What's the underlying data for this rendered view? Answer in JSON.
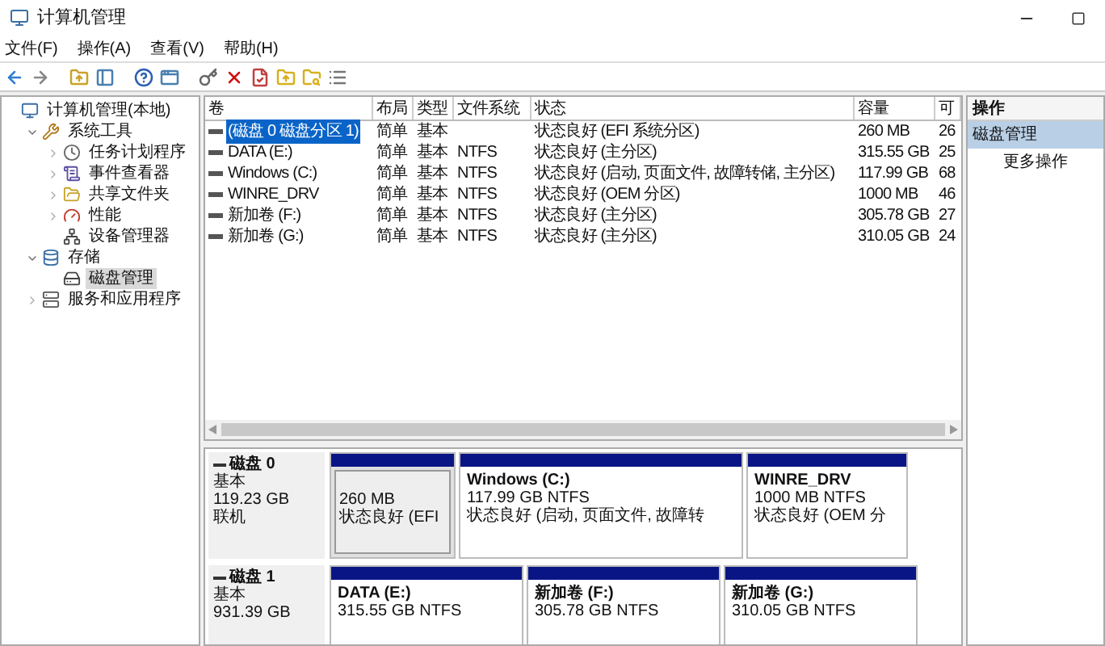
{
  "window": {
    "title": "计算机管理"
  },
  "menu": [
    "文件(F)",
    "操作(A)",
    "查看(V)",
    "帮助(H)"
  ],
  "tree": [
    {
      "label": "计算机管理(本地)",
      "selected": false,
      "children": [
        {
          "label": "系统工具",
          "expanded": true,
          "selected": false,
          "children": [
            {
              "label": "任务计划程序",
              "expanded": false,
              "selected": false
            },
            {
              "label": "事件查看器",
              "expanded": false,
              "selected": false
            },
            {
              "label": "共享文件夹",
              "expanded": false,
              "selected": false
            },
            {
              "label": "性能",
              "expanded": false,
              "selected": false
            },
            {
              "label": "设备管理器",
              "selected": false
            }
          ]
        },
        {
          "label": "存储",
          "expanded": true,
          "selected": false,
          "children": [
            {
              "label": "磁盘管理",
              "selected": true
            }
          ]
        },
        {
          "label": "服务和应用程序",
          "expanded": false,
          "selected": false
        }
      ]
    }
  ],
  "table": {
    "columns": [
      "卷",
      "布局",
      "类型",
      "文件系统",
      "状态",
      "容量",
      "可"
    ],
    "rows": [
      {
        "cells": [
          "(磁盘 0 磁盘分区 1)",
          "简单",
          "基本",
          "",
          "状态良好 (EFI 系统分区)",
          "260 MB",
          "26"
        ],
        "selected": true
      },
      {
        "cells": [
          "DATA (E:)",
          "简单",
          "基本",
          "NTFS",
          "状态良好 (主分区)",
          "315.55 GB",
          "25"
        ],
        "selected": false
      },
      {
        "cells": [
          "Windows (C:)",
          "简单",
          "基本",
          "NTFS",
          "状态良好 (启动, 页面文件, 故障转储, 主分区)",
          "117.99 GB",
          "68"
        ],
        "selected": false
      },
      {
        "cells": [
          "WINRE_DRV",
          "简单",
          "基本",
          "NTFS",
          "状态良好 (OEM 分区)",
          "1000 MB",
          "46"
        ],
        "selected": false
      },
      {
        "cells": [
          "新加卷 (F:)",
          "简单",
          "基本",
          "NTFS",
          "状态良好 (主分区)",
          "305.78 GB",
          "27"
        ],
        "selected": false
      },
      {
        "cells": [
          "新加卷 (G:)",
          "简单",
          "基本",
          "NTFS",
          "状态良好 (主分区)",
          "310.05 GB",
          "24"
        ],
        "selected": false
      }
    ]
  },
  "disks": [
    {
      "name": "磁盘 0",
      "type": "基本",
      "size": "119.23 GB",
      "status": "联机",
      "partitions": [
        {
          "size": "260 MB",
          "status": "状态良好 (EFI",
          "selected": true
        },
        {
          "label": "Windows (C:)",
          "size": "117.99 GB NTFS",
          "status": "状态良好 (启动, 页面文件, 故障转",
          "selected": false
        },
        {
          "label": "WINRE_DRV",
          "size": "1000 MB NTFS",
          "status": "状态良好 (OEM 分",
          "selected": false
        }
      ]
    },
    {
      "name": "磁盘 1",
      "type": "基本",
      "size": "931.39 GB",
      "partitions": [
        {
          "label": "DATA (E:)",
          "size": "315.55 GB NTFS",
          "selected": false
        },
        {
          "label": "新加卷 (F:)",
          "size": "305.78 GB NTFS",
          "selected": false
        },
        {
          "label": "新加卷 (G:)",
          "size": "310.05 GB NTFS",
          "selected": false
        }
      ]
    }
  ],
  "actions": {
    "header": "操作",
    "items": [
      {
        "label": "磁盘管理",
        "kind": "section"
      },
      {
        "label": "更多操作",
        "kind": "item"
      }
    ]
  }
}
